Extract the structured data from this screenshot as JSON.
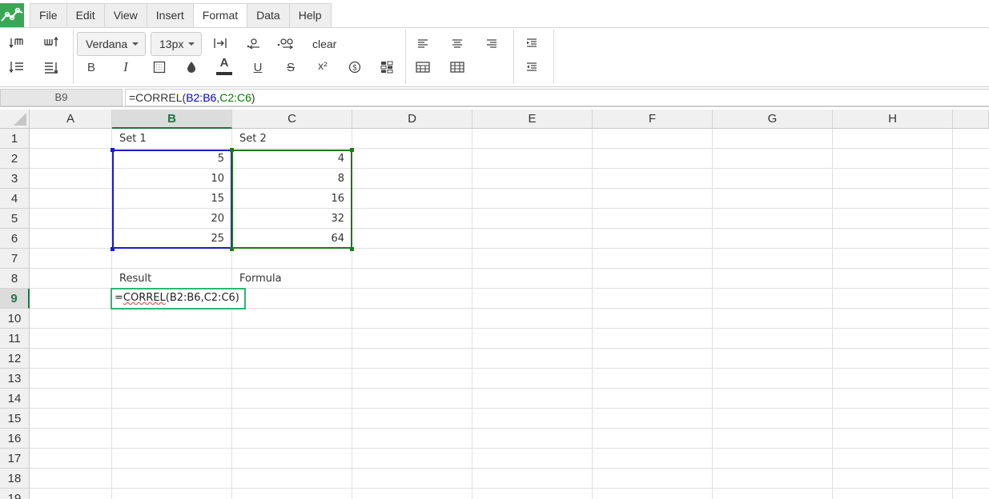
{
  "menu": {
    "items": [
      "File",
      "Edit",
      "View",
      "Insert",
      "Format",
      "Data",
      "Help"
    ],
    "active": "Format"
  },
  "toolbar": {
    "font_family": "Verdana",
    "font_size": "13px",
    "clear_label": "clear",
    "bold_label": "B",
    "italic_label": "I",
    "underline_label": "U",
    "strike_label": "S",
    "text_color_label": "A",
    "superscript_label": "x²"
  },
  "formula_bar": {
    "name_box": "B9",
    "prefix": "=CORREL(",
    "ref1": "B2:B6",
    "comma": ",",
    "ref2": "C2:C6",
    "suffix": ")"
  },
  "grid": {
    "columns": [
      "A",
      "B",
      "C",
      "D",
      "E",
      "F",
      "G",
      "H"
    ],
    "selected_column": "B",
    "rows": [
      "1",
      "2",
      "3",
      "4",
      "5",
      "6",
      "7",
      "8",
      "9",
      "10",
      "11",
      "12",
      "13",
      "14",
      "15",
      "16",
      "17",
      "18",
      "19"
    ],
    "selected_row": "9",
    "cells": {
      "B1": "Set 1",
      "C1": "Set 2",
      "B2": "5",
      "B3": "10",
      "B4": "15",
      "B5": "20",
      "B6": "25",
      "C2": "4",
      "C3": "8",
      "C4": "16",
      "C5": "32",
      "C6": "64",
      "B8": "Result",
      "C8": "Formula"
    }
  },
  "editor": {
    "prefix": "=",
    "func": "CORREL",
    "args": "(B2:B6,C2:C6)"
  },
  "colors": {
    "accent": "#217346",
    "ref_blue": "#0000cc",
    "ref_green": "#007a00",
    "editor_border": "#2bb673",
    "logo": "#3aa757"
  }
}
